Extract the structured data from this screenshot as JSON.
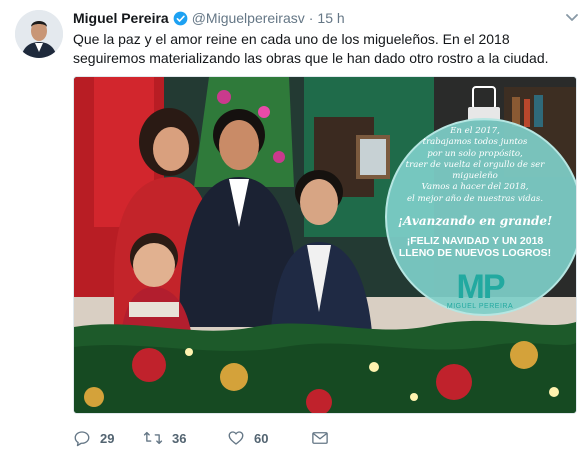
{
  "tweet": {
    "author_name": "Miguel Pereira",
    "handle": "@Miguelpereirasv",
    "separator": "·",
    "time": "15 h",
    "text": "Que la paz y el amor reine en cada uno de los migueleños.  En el 2018 seguiremos materializando las obras que le han dado otro rostro a la ciudad.",
    "verified": true,
    "icons": {
      "avatar": "avatar-portrait",
      "verified": "verified-badge-icon",
      "more": "chevron-down-icon"
    }
  },
  "media": {
    "ornament_lines": [
      "En el 2017,",
      "trabajamos todos juntos",
      "por un solo propósito,",
      "traer de vuelta el orgullo de ser migueleño",
      "Vamos a hacer del 2018,",
      "el mejor año de nuestras vidas."
    ],
    "slogan": "¡Avanzando en grande!",
    "greeting_lines": [
      "¡FELIZ NAVIDAD Y UN 2018",
      "LLENO DE NUEVOS LOGROS!"
    ],
    "logo_letters": "MP",
    "logo_name": "MIGUEL PEREIRA",
    "colors": {
      "ornament": "#7ecfc9",
      "logo": "#22a9a0",
      "wall_red": "#b81d24",
      "wall_green": "#1f6b4a",
      "garland": "#1d5a2a"
    }
  },
  "actions": {
    "reply_count": "29",
    "retweet_count": "36",
    "like_count": "60",
    "icons": {
      "reply": "reply-icon",
      "retweet": "retweet-icon",
      "like": "heart-icon",
      "message": "envelope-icon"
    }
  },
  "colors": {
    "text_primary": "#14171a",
    "text_secondary": "#657786",
    "verified_blue": "#1da1f2"
  }
}
